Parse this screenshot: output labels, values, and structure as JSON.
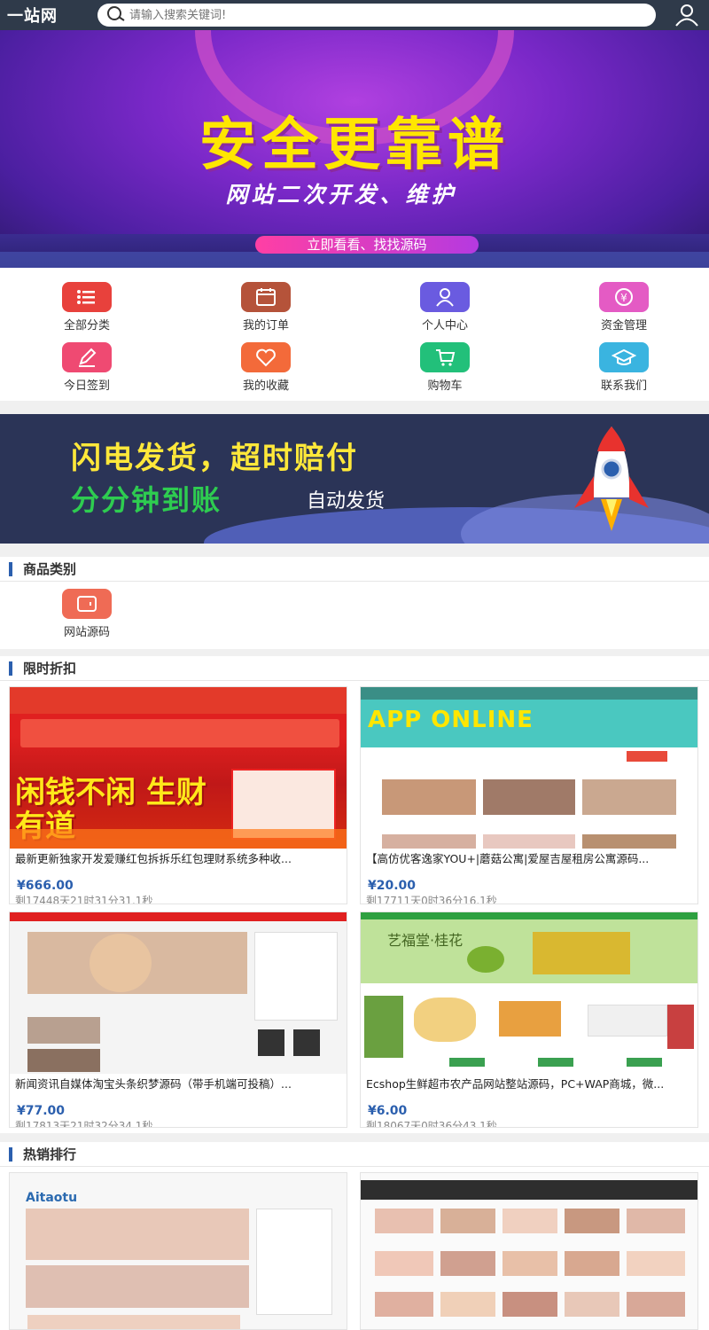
{
  "header": {
    "logo": "一站网",
    "search_placeholder": "请输入搜索关键词!"
  },
  "banner": {
    "title": "安全更靠谱",
    "subtitle": "网站二次开发、维护",
    "pill": "立即看看、找找源码",
    "slides": 2,
    "active_slide": 2
  },
  "menu": {
    "items": [
      {
        "label": "全部分类",
        "icon": "list-icon",
        "color": "#e8413c"
      },
      {
        "label": "我的订单",
        "icon": "calendar-icon",
        "color": "#b5533a"
      },
      {
        "label": "个人中心",
        "icon": "person-icon",
        "color": "#6a5be0"
      },
      {
        "label": "资金管理",
        "icon": "yen-icon",
        "color": "#e45bc4"
      },
      {
        "label": "今日签到",
        "icon": "pencil-icon",
        "color": "#ef4a72"
      },
      {
        "label": "我的收藏",
        "icon": "heart-icon",
        "color": "#f36a3a"
      },
      {
        "label": "购物车",
        "icon": "cart-icon",
        "color": "#22c07a"
      },
      {
        "label": "联系我们",
        "icon": "graduation-cap-icon",
        "color": "#3ab4e0"
      }
    ]
  },
  "promo": {
    "line1": "闪电发货，超时赔付",
    "line2": "分分钟到账",
    "line3": "自动发货"
  },
  "categories": {
    "title": "商品类别",
    "items": [
      {
        "label": "网站源码",
        "icon": "wallet-icon",
        "color": "#ef6b55"
      }
    ]
  },
  "flash_sale": {
    "title": "限时折扣",
    "products": [
      {
        "title": "最新更新独家开发爱赚红包拆拆乐红包理财系统多种收...",
        "price": "¥666.00",
        "remaining": "剩17448天21时31分31.1秒",
        "thumb_text": "闲钱不闲 生财有道"
      },
      {
        "title": "【高仿优客逸家YOU+|蘑菇公寓|爱屋吉屋租房公寓源码...",
        "price": "¥20.00",
        "remaining": "剩17711天0时36分16.1秒",
        "thumb_text": "APP ONLINE"
      },
      {
        "title": "新闻资讯自媒体淘宝头条织梦源码（带手机端可投稿）...",
        "price": "¥77.00",
        "remaining": "剩17813天21时32分34.1秒",
        "thumb_text": ""
      },
      {
        "title": "Ecshop生鲜超市农产品网站整站源码，PC+WAP商城，微...",
        "price": "¥6.00",
        "remaining": "剩18067天0时36分43.1秒",
        "thumb_text": "艺福堂·桂花"
      }
    ]
  },
  "hot": {
    "title": "热销排行",
    "products": [
      {
        "thumb_text": "Aitaotu"
      },
      {
        "thumb_text": ""
      }
    ]
  }
}
